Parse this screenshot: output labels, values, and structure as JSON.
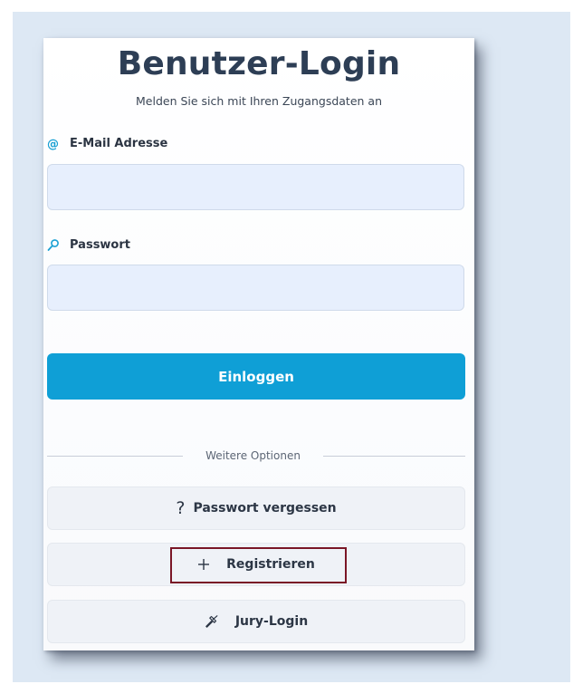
{
  "login": {
    "title": "Benutzer-Login",
    "subtitle": "Melden Sie sich mit Ihren Zugangsdaten an",
    "email_label": "E-Mail Adresse",
    "email_icon": "at-icon",
    "email_value": "",
    "password_label": "Passwort",
    "password_icon": "key-icon",
    "password_value": "",
    "submit_label": "Einloggen",
    "accent_color": "#0f9fd6"
  },
  "options": {
    "divider_label": "Weitere Optionen",
    "forgot_password": {
      "label": "Passwort vergessen",
      "icon": "question-icon"
    },
    "register": {
      "label": "Registrieren",
      "icon": "plus-icon",
      "highlight_color": "#7a1626"
    },
    "jury_login": {
      "label": "Jury-Login",
      "icon": "hammer-icon"
    }
  }
}
